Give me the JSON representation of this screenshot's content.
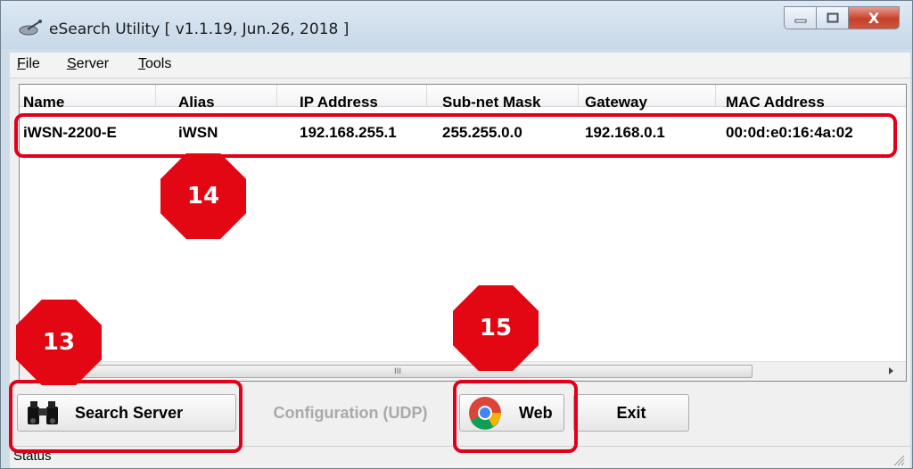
{
  "window": {
    "title": "eSearch Utility [ v1.1.19, Jun.26, 2018 ]",
    "close_glyph": "X"
  },
  "menu": [
    "File",
    "Server",
    "Tools"
  ],
  "table": {
    "columns": [
      "Name",
      "Alias",
      "IP Address",
      "Sub-net Mask",
      "Gateway",
      "MAC Address"
    ],
    "rows": [
      [
        "iWSN-2200-E",
        "iWSN",
        "192.168.255.1",
        "255.255.0.0",
        "192.168.0.1",
        "00:0d:e0:16:4a:02"
      ]
    ],
    "scroll_grip": "III"
  },
  "buttons": {
    "search": "Search Server",
    "config": "Configuration (UDP)",
    "web": "Web",
    "exit": "Exit"
  },
  "status": {
    "label": "Status"
  },
  "callouts": {
    "c13": "13",
    "c14": "14",
    "c15": "15"
  },
  "colors": {
    "highlight": "#e1001a",
    "callout": "#e30613"
  }
}
